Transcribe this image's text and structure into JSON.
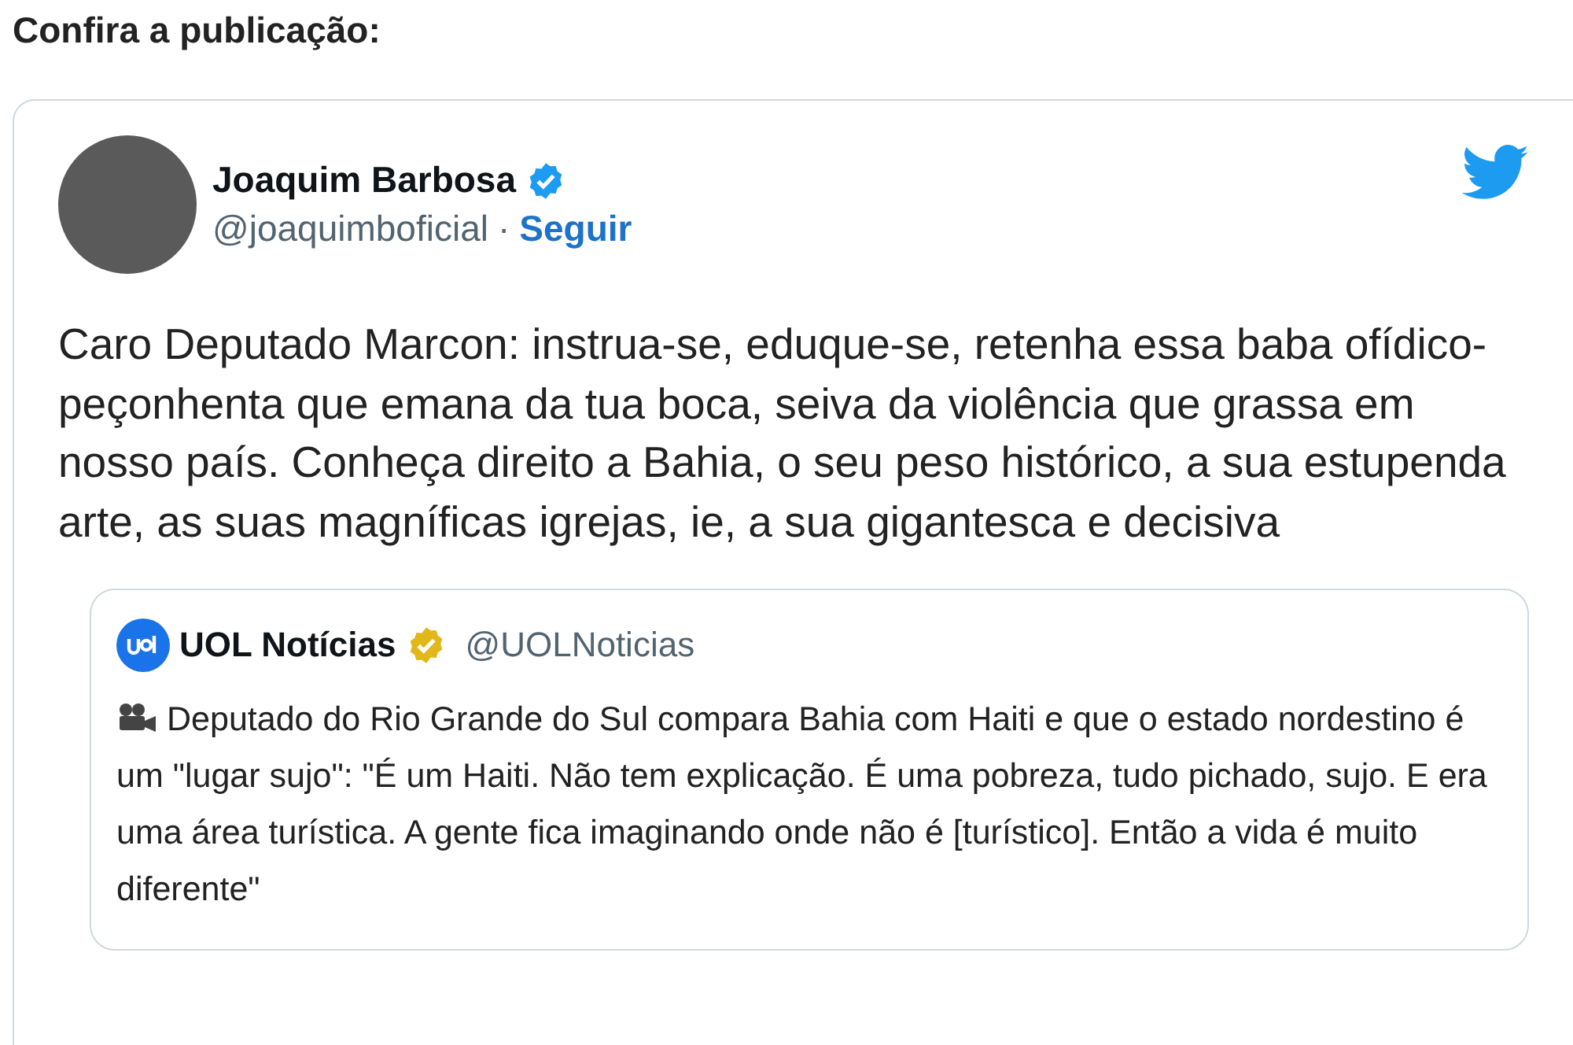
{
  "heading": "Confira a publicação:",
  "tweet": {
    "author": {
      "name": "Joaquim Barbosa",
      "verified": true,
      "handle": "@joaquimboficial",
      "separator": "·",
      "follow_link": "Seguir"
    },
    "text": "Caro Deputado Marcon: instrua-se, eduque-se, retenha essa baba ofídico-peçonhenta que emana da tua boca, seiva da violência que grassa em nosso país. Conheça direito a Bahia, o seu peso histórico, a sua estupenda arte, as suas magníficas igrejas, ie, a sua gigantesca e decisiva",
    "quoted": {
      "name": "UOL Notícias",
      "verified": true,
      "handle": "@UOLNoticias",
      "text": "Deputado do Rio Grande do Sul compara Bahia com Haiti e que o estado nordestino é um \"lugar sujo\": \"É um Haiti. Não tem explicação. É uma pobreza, tudo pichado, sujo. E era uma área turística. A gente fica imaginando onde não é [turístico]. Então a vida é muito diferente\""
    }
  }
}
